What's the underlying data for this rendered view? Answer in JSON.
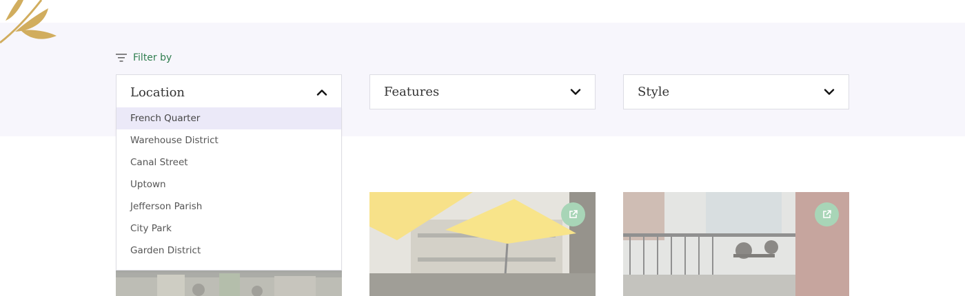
{
  "filter": {
    "label": "Filter by"
  },
  "selects": {
    "location": {
      "label": "Location",
      "expanded": true
    },
    "features": {
      "label": "Features",
      "expanded": false
    },
    "style": {
      "label": "Style",
      "expanded": false
    }
  },
  "location_options": [
    {
      "label": "French Quarter",
      "highlighted": true
    },
    {
      "label": "Warehouse District",
      "highlighted": false
    },
    {
      "label": "Canal Street",
      "highlighted": false
    },
    {
      "label": "Uptown",
      "highlighted": false
    },
    {
      "label": "Jefferson Parish",
      "highlighted": false
    },
    {
      "label": "City Park",
      "highlighted": false
    },
    {
      "label": "Garden District",
      "highlighted": false
    }
  ],
  "cards": [
    {
      "image": "restaurant-patio-photo"
    },
    {
      "image": "yellow-umbrella-balcony-photo",
      "icon": "external-link-icon"
    },
    {
      "image": "wrought-iron-balcony-photo",
      "icon": "external-link-icon"
    }
  ],
  "colors": {
    "accent_green": "#2f7d4f",
    "band_background": "#f7f6fc",
    "highlight_option": "#ebe9f8",
    "icon_badge": "#a8d5b7",
    "leaf_gold": "#d1ad5e"
  }
}
